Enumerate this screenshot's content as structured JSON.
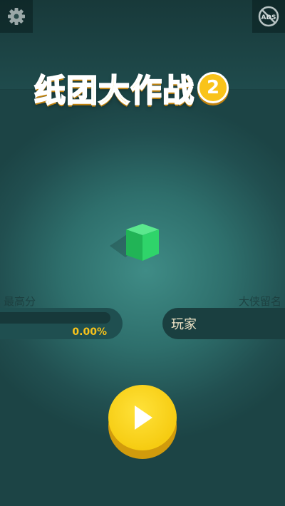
{
  "title": {
    "main": "纸团大作战",
    "number": "2"
  },
  "toolbar": {
    "settings_icon": "gear-icon",
    "no_ads_icon": "no-ads-icon",
    "no_ads_text": "ADS"
  },
  "stats": {
    "high_score_label": "最高分",
    "high_score_value": "0.00%",
    "high_score_progress": 0.0,
    "name_label": "大侠留名",
    "name_value": "玩家"
  },
  "play_icon": "play-icon",
  "colors": {
    "accent": "#f9c31a",
    "cube": "#2fd46a",
    "background": "#2e6f6c"
  }
}
